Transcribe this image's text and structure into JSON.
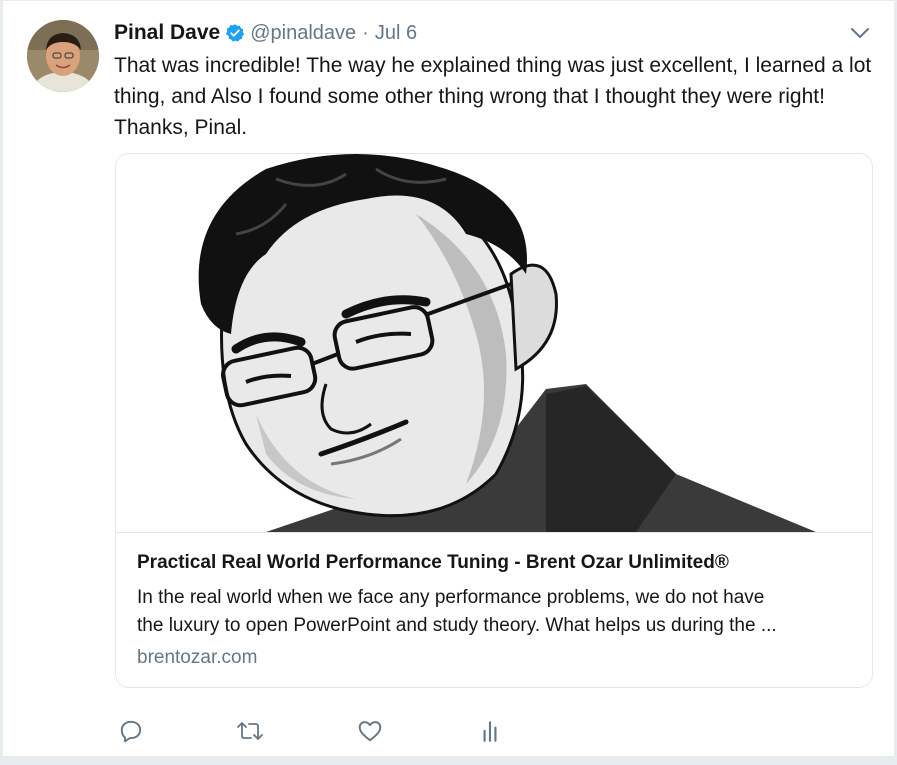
{
  "tweet": {
    "author_name": "Pinal Dave",
    "handle": "@pinaldave",
    "separator": "·",
    "date": "Jul 6",
    "text": "That was incredible! The way he explained thing was just excellent, I learned a lot\nthing, and Also I found some other thing wrong that I thought they were right!\nThanks, Pinal.",
    "verified": true
  },
  "card": {
    "title": "Practical Real World Performance Tuning - Brent Ozar Unlimited®",
    "description": "In the real world when we face any performance problems, we do not have\nthe luxury to open PowerPoint and study theory. What helps us during the ...",
    "domain": "brentozar.com",
    "image_icon": "illustrated-portrait"
  },
  "actions": [
    {
      "icon": "reply-icon"
    },
    {
      "icon": "retweet-icon"
    },
    {
      "icon": "like-icon"
    },
    {
      "icon": "analytics-icon"
    }
  ],
  "colors": {
    "text": "#14171a",
    "secondary": "#657786",
    "verified": "#1da1f2",
    "border": "#e1e8ed"
  }
}
